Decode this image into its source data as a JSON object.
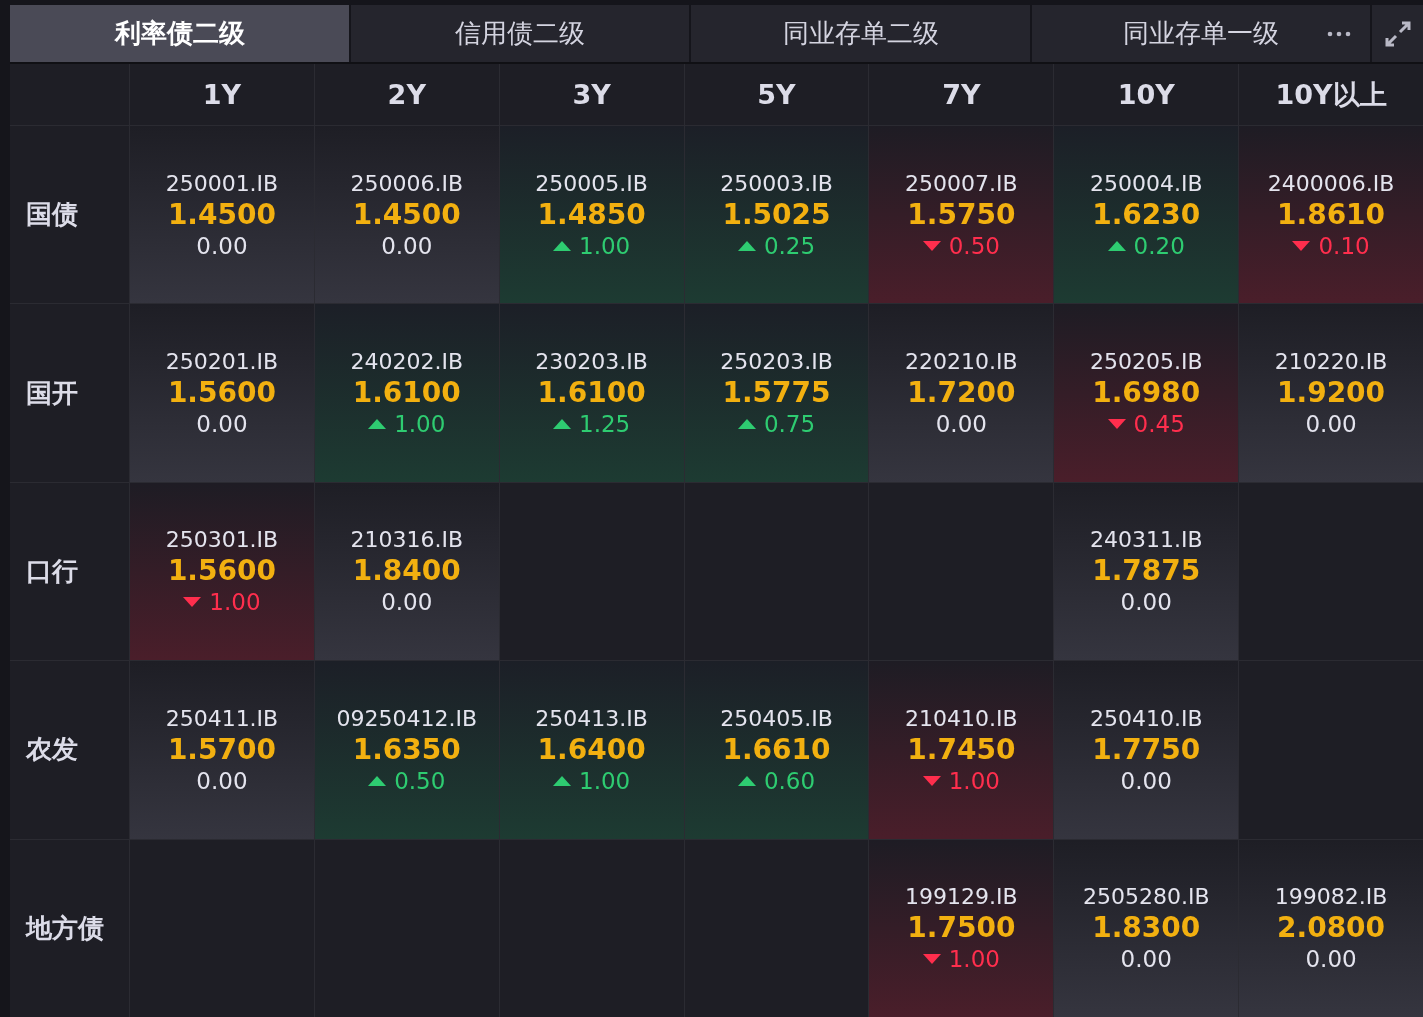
{
  "tabs": [
    {
      "label": "利率债二级",
      "selected": true
    },
    {
      "label": "信用债二级",
      "selected": false
    },
    {
      "label": "同业存单二级",
      "selected": false
    },
    {
      "label": "同业存单一级",
      "selected": false
    }
  ],
  "columns": [
    "1Y",
    "2Y",
    "3Y",
    "5Y",
    "7Y",
    "10Y",
    "10Y以上"
  ],
  "rows": [
    {
      "label": "国债",
      "cells": [
        {
          "kind": "flat",
          "code": "250001.IB",
          "yield": "1.4500",
          "change": "0.00"
        },
        {
          "kind": "flat",
          "code": "250006.IB",
          "yield": "1.4500",
          "change": "0.00"
        },
        {
          "kind": "up",
          "code": "250005.IB",
          "yield": "1.4850",
          "change": "1.00"
        },
        {
          "kind": "up",
          "code": "250003.IB",
          "yield": "1.5025",
          "change": "0.25"
        },
        {
          "kind": "down",
          "code": "250007.IB",
          "yield": "1.5750",
          "change": "0.50"
        },
        {
          "kind": "up",
          "code": "250004.IB",
          "yield": "1.6230",
          "change": "0.20"
        },
        {
          "kind": "down",
          "code": "2400006.IB",
          "yield": "1.8610",
          "change": "0.10"
        }
      ]
    },
    {
      "label": "国开",
      "cells": [
        {
          "kind": "flat",
          "code": "250201.IB",
          "yield": "1.5600",
          "change": "0.00"
        },
        {
          "kind": "up",
          "code": "240202.IB",
          "yield": "1.6100",
          "change": "1.00"
        },
        {
          "kind": "up",
          "code": "230203.IB",
          "yield": "1.6100",
          "change": "1.25"
        },
        {
          "kind": "up",
          "code": "250203.IB",
          "yield": "1.5775",
          "change": "0.75"
        },
        {
          "kind": "flat",
          "code": "220210.IB",
          "yield": "1.7200",
          "change": "0.00"
        },
        {
          "kind": "down",
          "code": "250205.IB",
          "yield": "1.6980",
          "change": "0.45"
        },
        {
          "kind": "flat",
          "code": "210220.IB",
          "yield": "1.9200",
          "change": "0.00"
        }
      ]
    },
    {
      "label": "口行",
      "cells": [
        {
          "kind": "down",
          "code": "250301.IB",
          "yield": "1.5600",
          "change": "1.00"
        },
        {
          "kind": "flat",
          "code": "210316.IB",
          "yield": "1.8400",
          "change": "0.00"
        },
        {
          "kind": "empty"
        },
        {
          "kind": "empty"
        },
        {
          "kind": "empty"
        },
        {
          "kind": "flat",
          "code": "240311.IB",
          "yield": "1.7875",
          "change": "0.00"
        },
        {
          "kind": "empty"
        }
      ]
    },
    {
      "label": "农发",
      "cells": [
        {
          "kind": "flat",
          "code": "250411.IB",
          "yield": "1.5700",
          "change": "0.00"
        },
        {
          "kind": "up",
          "code": "09250412.IB",
          "yield": "1.6350",
          "change": "0.50"
        },
        {
          "kind": "up",
          "code": "250413.IB",
          "yield": "1.6400",
          "change": "1.00"
        },
        {
          "kind": "up",
          "code": "250405.IB",
          "yield": "1.6610",
          "change": "0.60"
        },
        {
          "kind": "down",
          "code": "210410.IB",
          "yield": "1.7450",
          "change": "1.00"
        },
        {
          "kind": "flat",
          "code": "250410.IB",
          "yield": "1.7750",
          "change": "0.00"
        },
        {
          "kind": "empty"
        }
      ]
    },
    {
      "label": "地方债",
      "cells": [
        {
          "kind": "empty"
        },
        {
          "kind": "empty"
        },
        {
          "kind": "empty"
        },
        {
          "kind": "empty"
        },
        {
          "kind": "down",
          "code": "199129.IB",
          "yield": "1.7500",
          "change": "1.00"
        },
        {
          "kind": "flat",
          "code": "2505280.IB",
          "yield": "1.8300",
          "change": "0.00"
        },
        {
          "kind": "flat",
          "code": "199082.IB",
          "yield": "2.0800",
          "change": "0.00"
        }
      ]
    }
  ]
}
